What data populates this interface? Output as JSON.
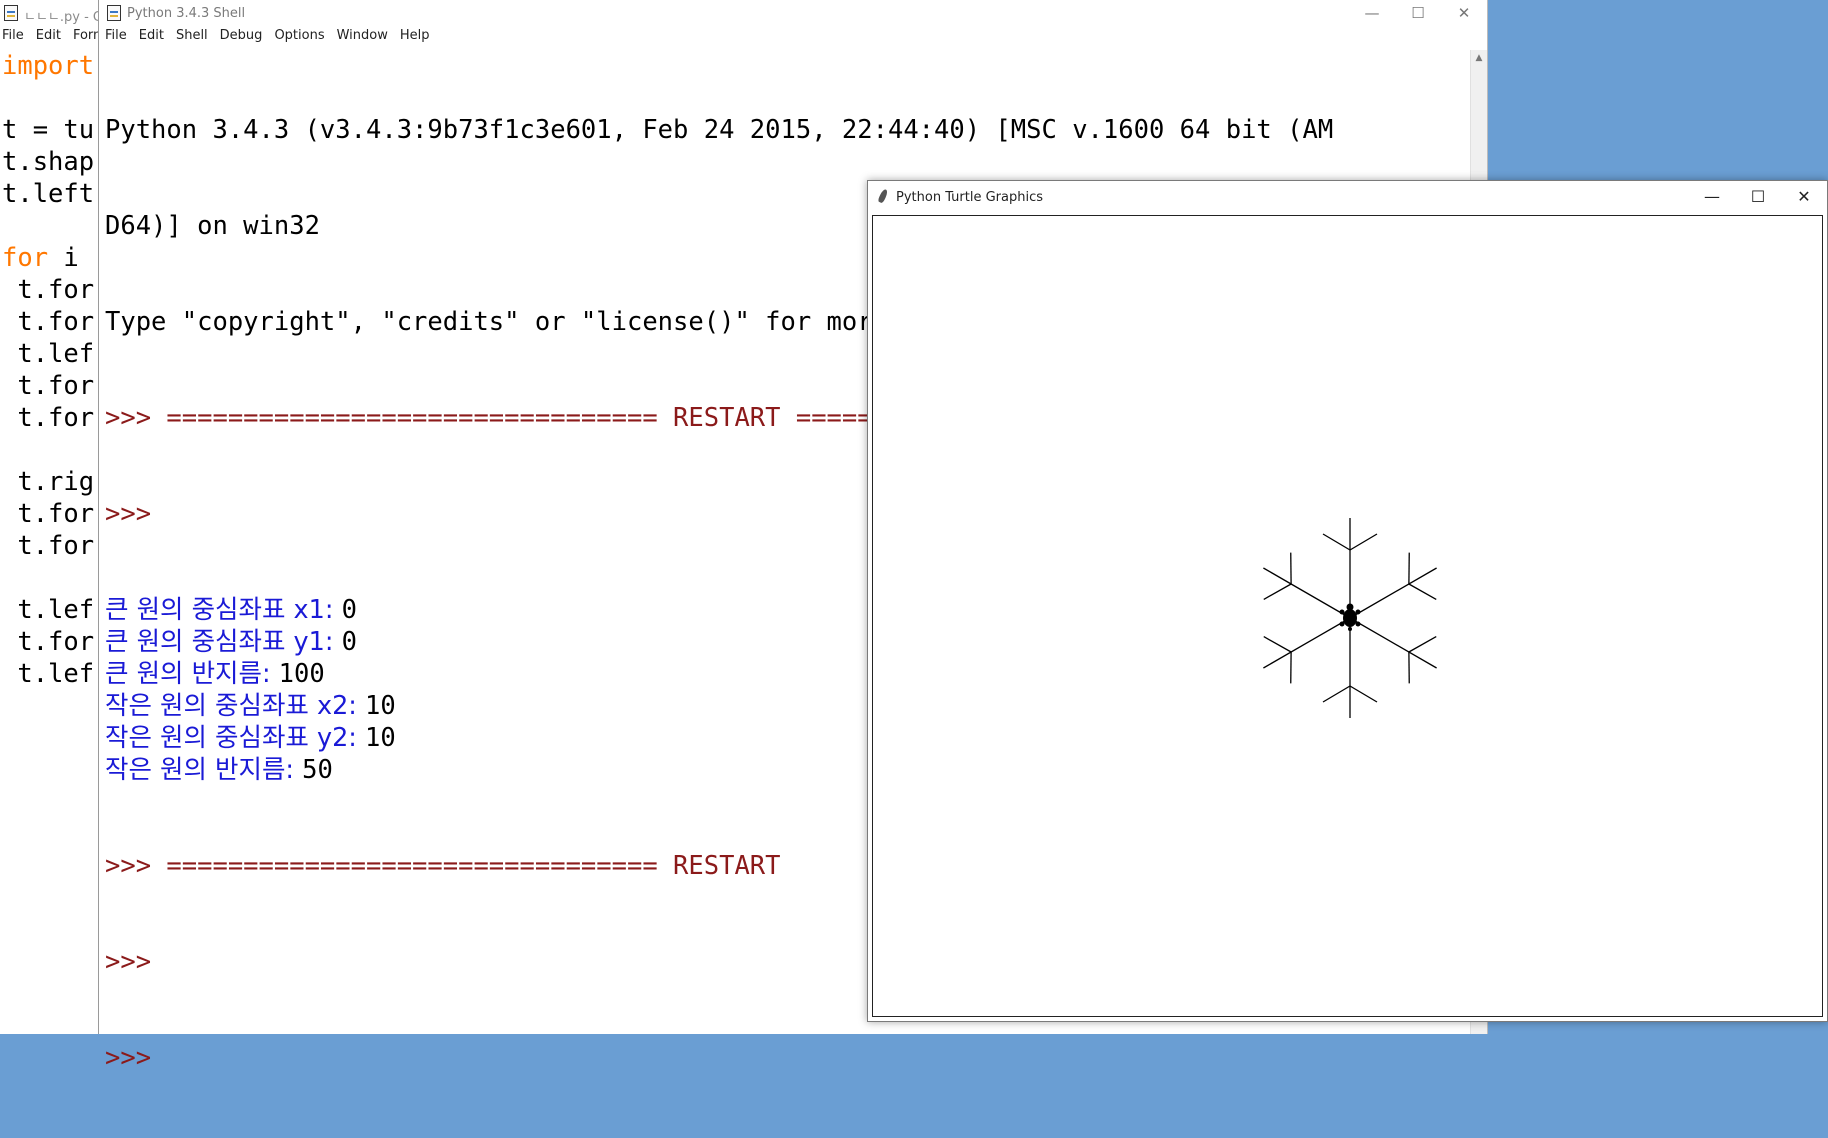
{
  "editor": {
    "title": "ㄴㄴㄴ.py - C",
    "menu": [
      "File",
      "Edit",
      "Forma"
    ],
    "code": [
      {
        "kw": "import",
        "rest": ""
      },
      {
        "kw": "",
        "rest": ""
      },
      {
        "kw": "",
        "rest": "t = tu"
      },
      {
        "kw": "",
        "rest": "t.shap"
      },
      {
        "kw": "",
        "rest": "t.left"
      },
      {
        "kw": "",
        "rest": ""
      },
      {
        "kw": "for",
        "rest": " i"
      },
      {
        "kw": "",
        "rest": " t.for"
      },
      {
        "kw": "",
        "rest": " t.for"
      },
      {
        "kw": "",
        "rest": " t.lef"
      },
      {
        "kw": "",
        "rest": " t.for"
      },
      {
        "kw": "",
        "rest": " t.for"
      },
      {
        "kw": "",
        "rest": ""
      },
      {
        "kw": "",
        "rest": " t.rig"
      },
      {
        "kw": "",
        "rest": " t.for"
      },
      {
        "kw": "",
        "rest": " t.for"
      },
      {
        "kw": "",
        "rest": ""
      },
      {
        "kw": "",
        "rest": " t.lef"
      },
      {
        "kw": "",
        "rest": " t.for"
      },
      {
        "kw": "",
        "rest": " t.lef"
      }
    ]
  },
  "shell": {
    "title": "Python 3.4.3 Shell",
    "menu": [
      "File",
      "Edit",
      "Shell",
      "Debug",
      "Options",
      "Window",
      "Help"
    ],
    "banner1": "Python 3.4.3 (v3.4.3:9b73f1c3e601, Feb 24 2015, 22:44:40) [MSC v.1600 64 bit (AM",
    "banner2": "D64)] on win32",
    "banner3": "Type \"copyright\", \"credits\" or \"license()\" for more information.",
    "restart1": ">>> ================================ RESTART ================================",
    "prompt": ">>>",
    "inputs": [
      {
        "label": "큰 원의 중심좌표 x1: ",
        "value": "0"
      },
      {
        "label": "큰 원의 중심좌표 y1: ",
        "value": "0"
      },
      {
        "label": "큰 원의 반지름: ",
        "value": "100"
      },
      {
        "label": "작은 원의 중심좌표 x2: ",
        "value": "10"
      },
      {
        "label": "작은 원의 중심좌표 y2: ",
        "value": "10"
      },
      {
        "label": "작은 원의 반지름: ",
        "value": "50"
      }
    ],
    "restart2": ">>> ================================ RESTART",
    "prompt2": ">>>",
    "prompt3": ">>>"
  },
  "turtle": {
    "title": "Python Turtle Graphics"
  },
  "controls": {
    "minimize": "—",
    "maximize": "☐",
    "close": "✕"
  },
  "colors": {
    "prompt": "#8b1a1a",
    "builtin_output": "#1a1ad6",
    "keyword": "#ff7700",
    "desktop": "#6a9ed3"
  }
}
